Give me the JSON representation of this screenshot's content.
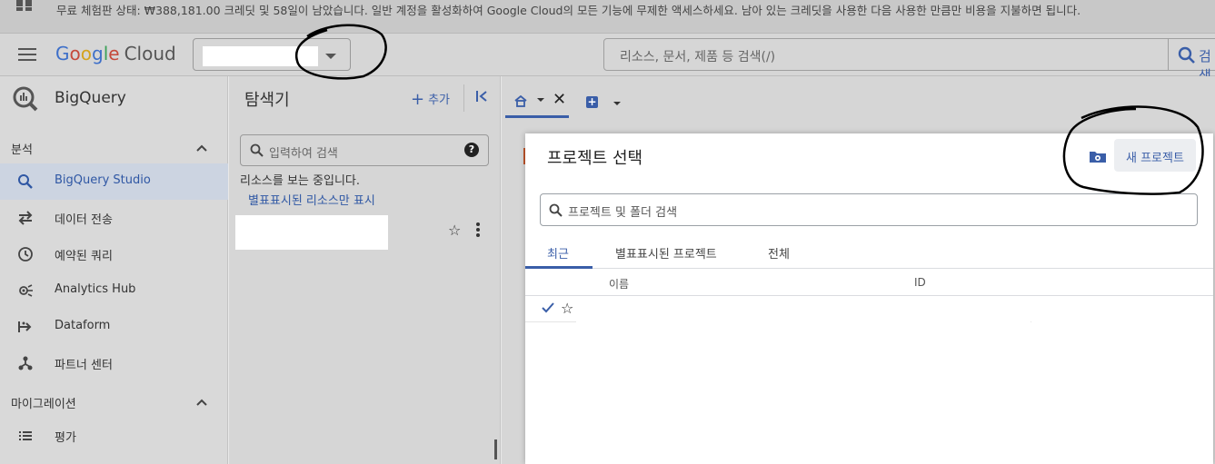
{
  "banner": {
    "message": "무료 체험판 상태: ₩388,181.00 크레딧 및 58일이 남았습니다. 일반 계정을 활성화하여 Google Cloud의 모든 기능에 무제한 액세스하세요. 남아 있는 크레딧을 사용한 다음 사용한 만큼만 비용을 지불하면 됩니다."
  },
  "header": {
    "logo": {
      "g": "G",
      "o1": "o",
      "o2": "o",
      "g2": "g",
      "l": "l",
      "e": "e",
      "cloud": "Cloud"
    },
    "search_placeholder": "리소스, 문서, 제품 등 검색(/)",
    "search_button": "검색"
  },
  "leftnav": {
    "product": "BigQuery",
    "sections": [
      {
        "label": "분석"
      },
      {
        "label": "마이그레이션"
      }
    ],
    "items": [
      {
        "label": "BigQuery Studio",
        "icon": "search-icon"
      },
      {
        "label": "데이터 전송",
        "icon": "transfer-arrows-icon"
      },
      {
        "label": "예약된 쿼리",
        "icon": "clock-icon"
      },
      {
        "label": "Analytics Hub",
        "icon": "analytics-hub-icon"
      },
      {
        "label": "Dataform",
        "icon": "dataform-icon"
      },
      {
        "label": "파트너 센터",
        "icon": "partner-center-icon"
      },
      {
        "label": "평가",
        "icon": "list-icon"
      }
    ]
  },
  "explorer": {
    "title": "탐색기",
    "add_label": "추가",
    "search_placeholder": "입력하여 검색",
    "status": "리소스를 보는 중입니다.",
    "starred_link": "별표표시된 리소스만 표시"
  },
  "dialog": {
    "title": "프로젝트 선택",
    "new_project": "새 프로젝트",
    "search_placeholder": "프로젝트 및 폴더 검색",
    "tabs": [
      "최근",
      "별표표시된 프로젝트",
      "전체"
    ],
    "columns": [
      "이름",
      "ID"
    ]
  },
  "colors": {
    "accent": "#3a5ea8",
    "active_bg": "#ccd4e1"
  }
}
